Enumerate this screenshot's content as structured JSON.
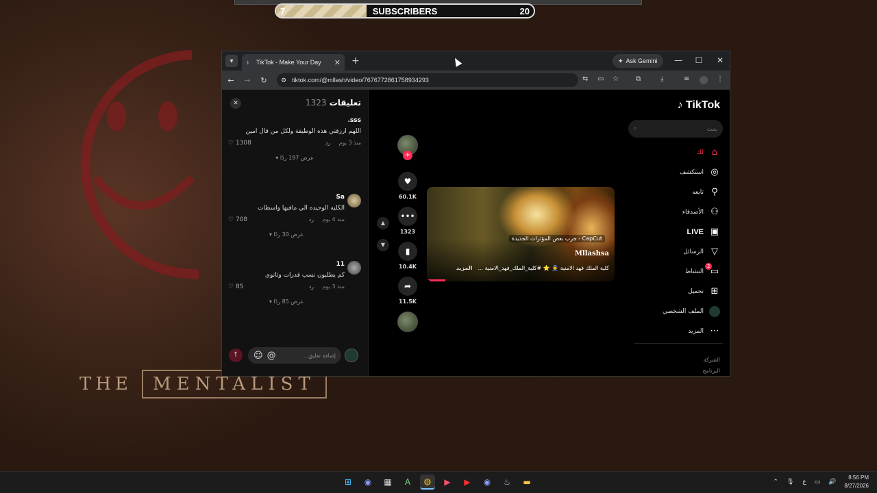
{
  "subscribers": {
    "current": "7",
    "label": "SUBSCRIBERS",
    "goal": "20",
    "progress": 0.35
  },
  "wallpaper": {
    "show_title_1": "THE",
    "show_title_2": "MENTALIST"
  },
  "browser": {
    "tab_title": "TikTok - Make Your Day",
    "new_tab": "+",
    "ask_gemini": "Ask Gemini",
    "url": "tiktok.com/@mllash/video/7676772861758934293"
  },
  "comments": {
    "title": "تعليقات",
    "count": "1323",
    "items": [
      {
        "user": "sss.",
        "text": "اللهم ارزقني هذه الوظيفة ولكل من قال امين",
        "time": "منذ 3 يوم",
        "reply": "رد",
        "likes": "1308",
        "more": "عرض 197 ردًا"
      },
      {
        "user": "Sa",
        "text": "الكليه الوحيده الي مافيها واسطات",
        "time": "منذ 4 يوم",
        "reply": "رد",
        "likes": "708",
        "more": "عرض 30 ردًا"
      },
      {
        "user": "11",
        "text": "كم يطلبون نسب قدرات وثانوي",
        "time": "منذ 3 يوم",
        "reply": "رد",
        "likes": "85",
        "more": "عرض 85 ردًا"
      }
    ],
    "placeholder": "إضافة تعليق..."
  },
  "video": {
    "capcut": "CapCut - جرب بعض المؤثرات الجديدة",
    "author": "Mllashsa",
    "desc": "كلية الملك فهد الامنية 👮 ⭐ #كلية_الملك_فهد_الامنية ...",
    "more": "المزيد",
    "progress": 0.1
  },
  "actions": {
    "likes": "60.1K",
    "comments": "1323",
    "saves": "10.4K",
    "shares": "11.5K"
  },
  "sidebar": {
    "logo": "TikTok",
    "search_placeholder": "بحث",
    "items": [
      {
        "label": "لك",
        "icon": "home-icon"
      },
      {
        "label": "استكشف",
        "icon": "compass-icon"
      },
      {
        "label": "تابعه",
        "icon": "follow-icon"
      },
      {
        "label": "الأصدقاء",
        "icon": "friends-icon"
      },
      {
        "label": "LIVE",
        "icon": "live-icon"
      },
      {
        "label": "الرسائل",
        "icon": "send-icon"
      },
      {
        "label": "النشاط",
        "icon": "inbox-icon",
        "badge": "2"
      },
      {
        "label": "تحميل",
        "icon": "upload-icon"
      },
      {
        "label": "الملف الشخصي",
        "icon": "profile-icon"
      },
      {
        "label": "المزيد",
        "icon": "more-icon"
      }
    ],
    "footer": [
      "الشركة",
      "البرنامج"
    ]
  },
  "taskbar": {
    "lang": "ع",
    "time": "8:56 PM",
    "date": "8/27/2026"
  },
  "colors": {
    "accent": "#fe2c55",
    "tab_bg": "#35363a",
    "frame": "#202124"
  }
}
